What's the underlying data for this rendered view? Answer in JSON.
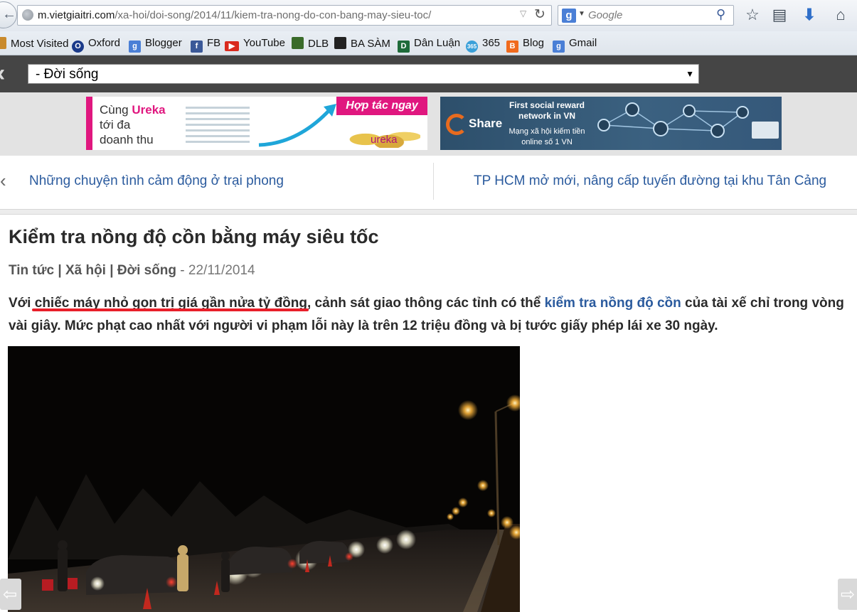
{
  "browser": {
    "url_domain": "m.vietgiaitri.com",
    "url_path": "/xa-hoi/doi-song/2014/11/kiem-tra-nong-do-con-bang-may-sieu-toc/",
    "search_placeholder": "Google",
    "search_engine_badge": "g"
  },
  "bookmarks": [
    {
      "label": "Most Visited",
      "icon": "most-visited-icon",
      "color": "#c98a2c"
    },
    {
      "label": "Oxford",
      "icon": "oxford-icon",
      "color": "#1a3a8a"
    },
    {
      "label": "Blogger",
      "icon": "google-icon",
      "color": "#4a7fd6"
    },
    {
      "label": "FB",
      "icon": "facebook-icon",
      "color": "#3b5998"
    },
    {
      "label": "YouTube",
      "icon": "youtube-icon",
      "color": "#d92a1e"
    },
    {
      "label": "DLB",
      "icon": "dlb-icon",
      "color": "#3a6b2a"
    },
    {
      "label": "BA SÀM",
      "icon": "basam-icon",
      "color": "#222222"
    },
    {
      "label": "Dân Luận",
      "icon": "danluan-icon",
      "color": "#1e6b3a"
    },
    {
      "label": "365",
      "icon": "365-icon",
      "color": "#3aa0d9"
    },
    {
      "label": "Blog",
      "icon": "blogger-icon",
      "color": "#f06a1d"
    },
    {
      "label": "Gmail",
      "icon": "google-icon",
      "color": "#4a7fd6"
    }
  ],
  "header": {
    "category_selected": "- Đời sống"
  },
  "ads": {
    "ureka": {
      "line1_prefix": "Cùng ",
      "brand": "Ureka",
      "line2": "tới đa",
      "line3": "doanh thu",
      "cta": "Hợp tác ngay",
      "logo": "ureka"
    },
    "share": {
      "word": "Share",
      "tagline1": "First social reward network in VN",
      "tagline2": "Mạng xã hội kiếm tiền online số 1 VN"
    }
  },
  "article_nav": {
    "prev": "Những chuyện tình cảm động ở trại phong",
    "next": "TP HCM mở mới, nâng cấp tuyến đường tại khu Tân Cảng"
  },
  "article": {
    "title": "Kiểm tra nồng độ cồn bằng máy siêu tốc",
    "meta_categories": "Tin tức | Xã hội | Đời sống",
    "meta_sep": " - ",
    "meta_date": "22/11/2014",
    "lead_1": "Với ",
    "lead_highlight": "chiếc máy nhỏ gọn trị giá gần nửa tỷ đồng",
    "lead_2": ", cảnh sát giao thông các tỉnh có thể ",
    "lead_link": "kiểm tra nồng độ cồn",
    "lead_3": " của tài xế chỉ trong vòng vài giây. Mức phạt cao nhất với người vi phạm lỗi này là trên 12 triệu đồng và bị tước giấy phép lái xe 30 ngày."
  },
  "colors": {
    "link": "#2b5b9e",
    "header_bg": "#454545",
    "underline_mark": "#e8202a",
    "ureka_pink": "#e0177f"
  }
}
